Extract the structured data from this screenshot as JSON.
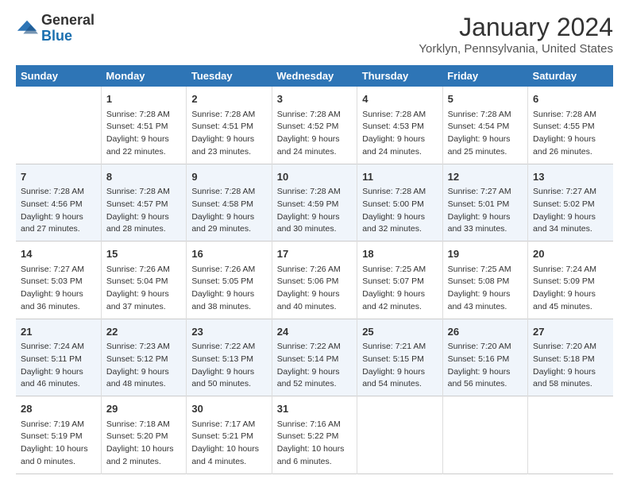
{
  "header": {
    "logo_general": "General",
    "logo_blue": "Blue",
    "month": "January 2024",
    "location": "Yorklyn, Pennsylvania, United States"
  },
  "days_of_week": [
    "Sunday",
    "Monday",
    "Tuesday",
    "Wednesday",
    "Thursday",
    "Friday",
    "Saturday"
  ],
  "weeks": [
    [
      {
        "day": "",
        "sunrise": "",
        "sunset": "",
        "daylight": ""
      },
      {
        "day": "1",
        "sunrise": "7:28 AM",
        "sunset": "4:51 PM",
        "daylight": "9 hours and 22 minutes."
      },
      {
        "day": "2",
        "sunrise": "7:28 AM",
        "sunset": "4:51 PM",
        "daylight": "9 hours and 23 minutes."
      },
      {
        "day": "3",
        "sunrise": "7:28 AM",
        "sunset": "4:52 PM",
        "daylight": "9 hours and 24 minutes."
      },
      {
        "day": "4",
        "sunrise": "7:28 AM",
        "sunset": "4:53 PM",
        "daylight": "9 hours and 24 minutes."
      },
      {
        "day": "5",
        "sunrise": "7:28 AM",
        "sunset": "4:54 PM",
        "daylight": "9 hours and 25 minutes."
      },
      {
        "day": "6",
        "sunrise": "7:28 AM",
        "sunset": "4:55 PM",
        "daylight": "9 hours and 26 minutes."
      }
    ],
    [
      {
        "day": "7",
        "sunrise": "7:28 AM",
        "sunset": "4:56 PM",
        "daylight": "9 hours and 27 minutes."
      },
      {
        "day": "8",
        "sunrise": "7:28 AM",
        "sunset": "4:57 PM",
        "daylight": "9 hours and 28 minutes."
      },
      {
        "day": "9",
        "sunrise": "7:28 AM",
        "sunset": "4:58 PM",
        "daylight": "9 hours and 29 minutes."
      },
      {
        "day": "10",
        "sunrise": "7:28 AM",
        "sunset": "4:59 PM",
        "daylight": "9 hours and 30 minutes."
      },
      {
        "day": "11",
        "sunrise": "7:28 AM",
        "sunset": "5:00 PM",
        "daylight": "9 hours and 32 minutes."
      },
      {
        "day": "12",
        "sunrise": "7:27 AM",
        "sunset": "5:01 PM",
        "daylight": "9 hours and 33 minutes."
      },
      {
        "day": "13",
        "sunrise": "7:27 AM",
        "sunset": "5:02 PM",
        "daylight": "9 hours and 34 minutes."
      }
    ],
    [
      {
        "day": "14",
        "sunrise": "7:27 AM",
        "sunset": "5:03 PM",
        "daylight": "9 hours and 36 minutes."
      },
      {
        "day": "15",
        "sunrise": "7:26 AM",
        "sunset": "5:04 PM",
        "daylight": "9 hours and 37 minutes."
      },
      {
        "day": "16",
        "sunrise": "7:26 AM",
        "sunset": "5:05 PM",
        "daylight": "9 hours and 38 minutes."
      },
      {
        "day": "17",
        "sunrise": "7:26 AM",
        "sunset": "5:06 PM",
        "daylight": "9 hours and 40 minutes."
      },
      {
        "day": "18",
        "sunrise": "7:25 AM",
        "sunset": "5:07 PM",
        "daylight": "9 hours and 42 minutes."
      },
      {
        "day": "19",
        "sunrise": "7:25 AM",
        "sunset": "5:08 PM",
        "daylight": "9 hours and 43 minutes."
      },
      {
        "day": "20",
        "sunrise": "7:24 AM",
        "sunset": "5:09 PM",
        "daylight": "9 hours and 45 minutes."
      }
    ],
    [
      {
        "day": "21",
        "sunrise": "7:24 AM",
        "sunset": "5:11 PM",
        "daylight": "9 hours and 46 minutes."
      },
      {
        "day": "22",
        "sunrise": "7:23 AM",
        "sunset": "5:12 PM",
        "daylight": "9 hours and 48 minutes."
      },
      {
        "day": "23",
        "sunrise": "7:22 AM",
        "sunset": "5:13 PM",
        "daylight": "9 hours and 50 minutes."
      },
      {
        "day": "24",
        "sunrise": "7:22 AM",
        "sunset": "5:14 PM",
        "daylight": "9 hours and 52 minutes."
      },
      {
        "day": "25",
        "sunrise": "7:21 AM",
        "sunset": "5:15 PM",
        "daylight": "9 hours and 54 minutes."
      },
      {
        "day": "26",
        "sunrise": "7:20 AM",
        "sunset": "5:16 PM",
        "daylight": "9 hours and 56 minutes."
      },
      {
        "day": "27",
        "sunrise": "7:20 AM",
        "sunset": "5:18 PM",
        "daylight": "9 hours and 58 minutes."
      }
    ],
    [
      {
        "day": "28",
        "sunrise": "7:19 AM",
        "sunset": "5:19 PM",
        "daylight": "10 hours and 0 minutes."
      },
      {
        "day": "29",
        "sunrise": "7:18 AM",
        "sunset": "5:20 PM",
        "daylight": "10 hours and 2 minutes."
      },
      {
        "day": "30",
        "sunrise": "7:17 AM",
        "sunset": "5:21 PM",
        "daylight": "10 hours and 4 minutes."
      },
      {
        "day": "31",
        "sunrise": "7:16 AM",
        "sunset": "5:22 PM",
        "daylight": "10 hours and 6 minutes."
      },
      {
        "day": "",
        "sunrise": "",
        "sunset": "",
        "daylight": ""
      },
      {
        "day": "",
        "sunrise": "",
        "sunset": "",
        "daylight": ""
      },
      {
        "day": "",
        "sunrise": "",
        "sunset": "",
        "daylight": ""
      }
    ]
  ],
  "labels": {
    "sunrise_prefix": "Sunrise: ",
    "sunset_prefix": "Sunset: ",
    "daylight_prefix": "Daylight: "
  }
}
